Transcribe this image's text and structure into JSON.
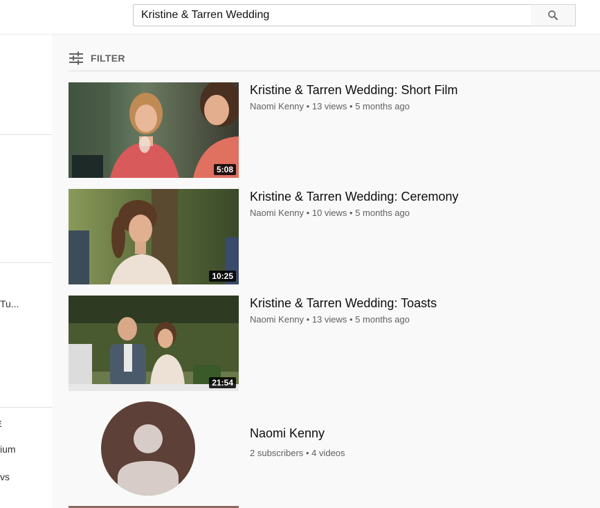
{
  "search": {
    "query": "Kristine & Tarren Wedding"
  },
  "sidebar": {
    "texts": [
      "Tu...",
      "E",
      "ium",
      "vs"
    ]
  },
  "filter": {
    "label": "FILTER"
  },
  "videos": [
    {
      "title": "Kristine & Tarren Wedding: Short Film",
      "channel": "Naomi Kenny",
      "views": "13 views",
      "age": "5 months ago",
      "duration": "5:08"
    },
    {
      "title": "Kristine & Tarren Wedding: Ceremony",
      "channel": "Naomi Kenny",
      "views": "10 views",
      "age": "5 months ago",
      "duration": "10:25"
    },
    {
      "title": "Kristine & Tarren Wedding: Toasts",
      "channel": "Naomi Kenny",
      "views": "13 views",
      "age": "5 months ago",
      "duration": "21:54"
    }
  ],
  "channel_result": {
    "name": "Naomi Kenny",
    "subscribers": "2 subscribers",
    "videos": "4 videos"
  },
  "icons": {
    "search": "search-icon",
    "filter": "filter-sliders-icon"
  },
  "colors": {
    "avatar_bg": "#5d4037",
    "avatar_figure": "#d7ccc8",
    "meta_text": "#606060"
  }
}
